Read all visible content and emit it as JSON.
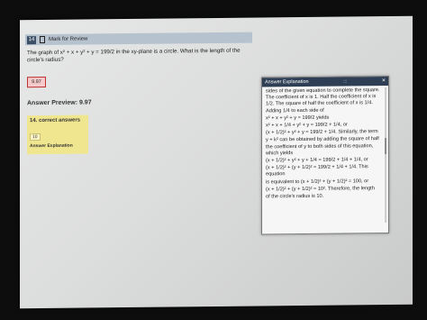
{
  "header": {
    "question_number": "14",
    "mark_review": "Mark for Review"
  },
  "question": {
    "text": "The graph of x² + x + y² + y = 199/2 in the xy-plane is a circle. What is the length of the circle's radius?"
  },
  "answer": {
    "value": "9.97"
  },
  "preview": {
    "label": "Answer Preview: 9.97"
  },
  "card": {
    "title": "14. correct answers",
    "value": "10",
    "button": "Answer Explanation"
  },
  "explanation": {
    "title": "Answer Explanation",
    "grip": ":::",
    "close": "×",
    "lines": [
      "sides of the given equation to complete the square. The coefficient of x is 1. Half the coefficient of x is 1/2. The square of half the coefficient of x is 1/4. Adding 1/4 to each side of",
      "x² + x + y² + y = 199/2 yields",
      "x² + x + 1/4 + y² + y = 199/2 + 1/4, or",
      "(x + 1/2)² + y² + y = 199/2 + 1/4. Similarly, the term",
      "y + k² can be obtained by adding the square of half the coefficient of y to both sides of this equation, which yields",
      "(x + 1/2)² + y² + y + 1/4 = 199/2 + 1/4 + 1/4, or",
      "(x + 1/2)² + (y + 1/2)² = 199/2 + 1/4 + 1/4. This equation",
      "is equivalent to (x + 1/2)² + (y + 1/2)² = 100, or",
      "(x + 1/2)² + (y + 1/2)² = 10². Therefore, the length",
      "of the circle's radius is 10."
    ]
  }
}
